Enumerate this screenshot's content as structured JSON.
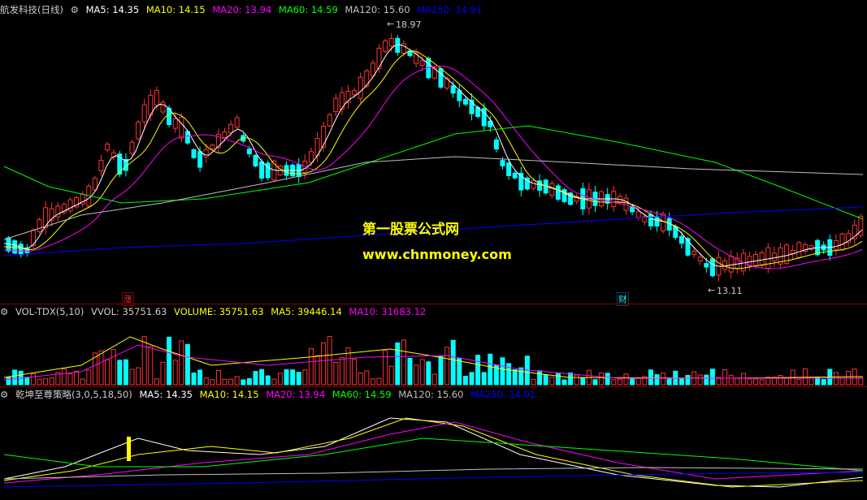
{
  "main": {
    "stock_title": "航发科技(日线)",
    "indicators": [
      {
        "label": "MA5: 14.35",
        "color": "#ffffff"
      },
      {
        "label": "MA10: 14.15",
        "color": "#ffff00"
      },
      {
        "label": "MA20: 13.94",
        "color": "#ff00ff"
      },
      {
        "label": "MA60: 14.59",
        "color": "#00ff00"
      },
      {
        "label": "MA120: 15.60",
        "color": "#c0c0c0"
      },
      {
        "label": "MA250: 14.91",
        "color": "#0000ff"
      }
    ],
    "high_label": "18.97",
    "low_label": "13.11",
    "marker_up": "涨",
    "marker_fin": "财"
  },
  "watermark": {
    "line1": "第一股票公式网",
    "line2": "www.chnmoney.com"
  },
  "volume": {
    "title": "VOL-TDX(5,10)",
    "indicators": [
      {
        "label": "VVOL: 35751.63",
        "color": "#cccccc"
      },
      {
        "label": "VOLUME: 35751.63",
        "color": "#ffff00"
      },
      {
        "label": "MA5: 39446.14",
        "color": "#ffff00"
      },
      {
        "label": "MA10: 31683.12",
        "color": "#ff00ff"
      }
    ]
  },
  "strategy": {
    "title": "乾坤至尊策略(3,0,5,18,50)",
    "indicators": [
      {
        "label": "MA5: 14.35",
        "color": "#ffffff"
      },
      {
        "label": "MA10: 14.15",
        "color": "#ffff00"
      },
      {
        "label": "MA20: 13.94",
        "color": "#ff00ff"
      },
      {
        "label": "MA60: 14.59",
        "color": "#00ff00"
      },
      {
        "label": "MA120: 15.60",
        "color": "#c0c0c0"
      },
      {
        "label": "MA250: 14.91",
        "color": "#0000ff"
      }
    ]
  },
  "colors": {
    "up": "#ff3333",
    "down": "#00ffff",
    "grid": "#8b0000"
  }
}
